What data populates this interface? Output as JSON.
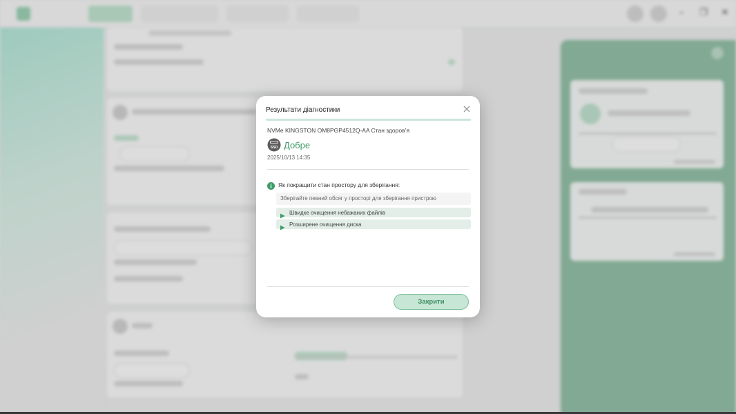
{
  "modal": {
    "title": "Результати діагностики",
    "device_line": "NVMe KINGSTON OM8PGP4512Q-AA Стан здоров’я",
    "status": "Добре",
    "ssd_badge": "SSD",
    "date": "2025/10/13 14:35",
    "tips_title": "Як покращити стан простору для зберігання:",
    "tips_description": "Зберігайте певний обсяг у просторі для зберігання пристрою",
    "actions": [
      {
        "label": "Швидке очищення небажаних файлів"
      },
      {
        "label": "Розширене очищення диска"
      }
    ],
    "close_button": "Закрити"
  },
  "icons": {
    "close": "close-icon",
    "ssd": "ssd-icon",
    "info": "info-icon",
    "play": "play-icon"
  },
  "colors": {
    "accent": "#3e9a66",
    "accent_light": "#c7e6d6",
    "panel_green": "#86b69b"
  }
}
